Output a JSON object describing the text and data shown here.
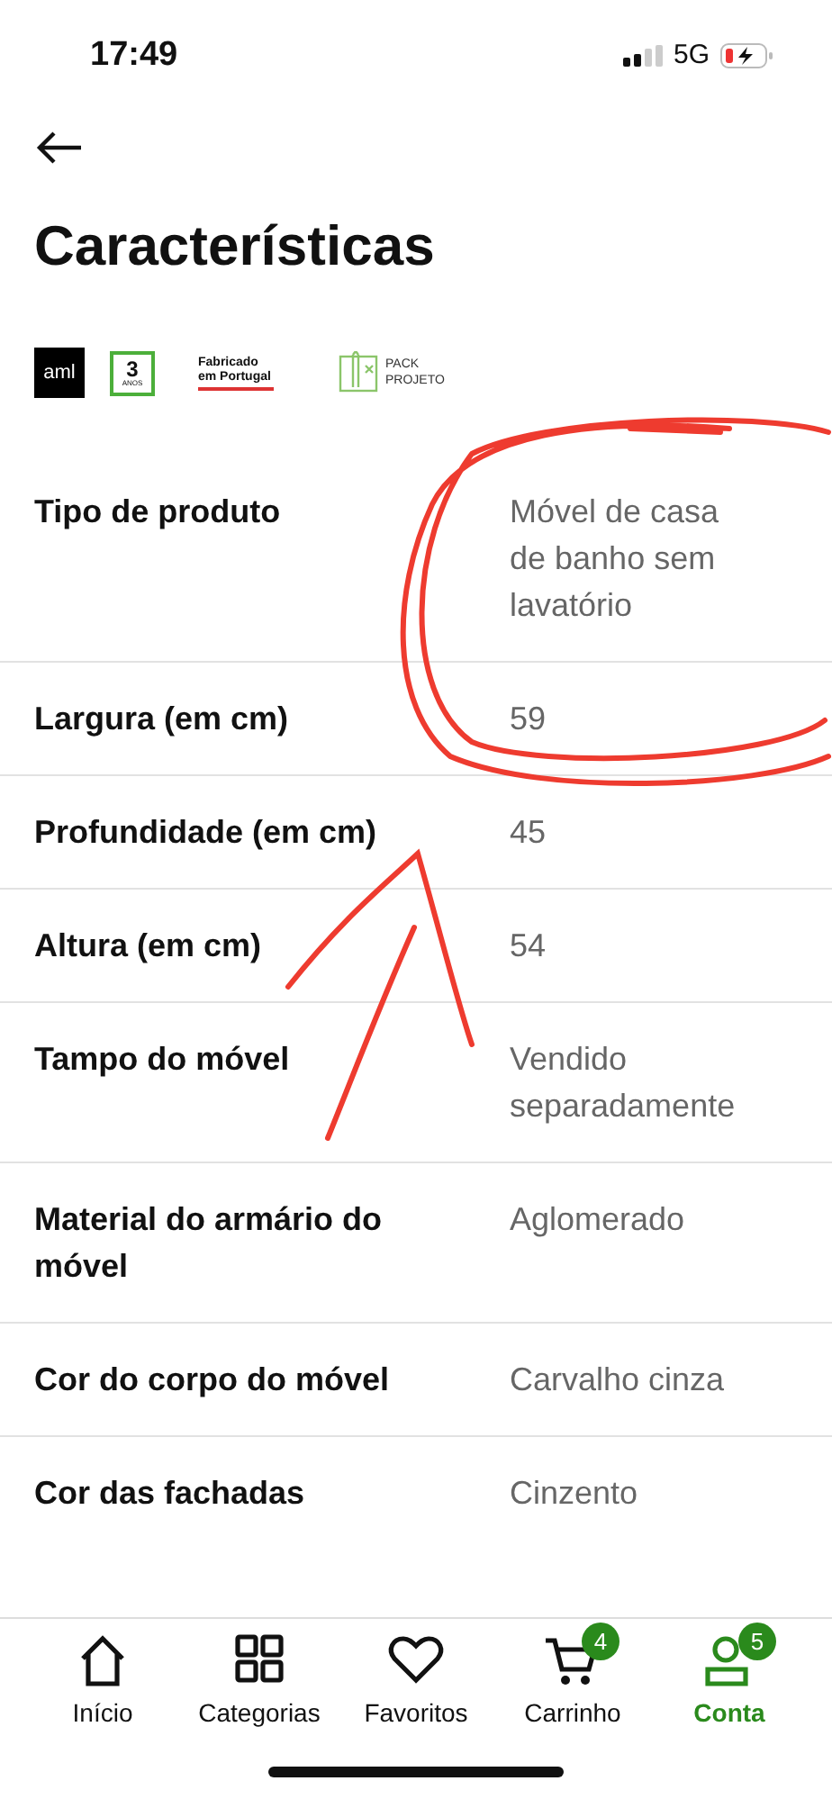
{
  "status_bar": {
    "time": "17:49",
    "network": "5G"
  },
  "header": {
    "title": "Características"
  },
  "badges": [
    {
      "kind": "aml",
      "text": "aml"
    },
    {
      "kind": "warranty",
      "text": "3",
      "sub": "ANOS"
    },
    {
      "kind": "made_in",
      "text": "Fabricado em Portugal"
    },
    {
      "kind": "pack",
      "text": "PACK PROJETO"
    }
  ],
  "specs": [
    {
      "label": "Tipo de produto",
      "value": "Móvel de casa de banho sem lavatório"
    },
    {
      "label": "Largura (em cm)",
      "value": "59"
    },
    {
      "label": "Profundidade (em cm)",
      "value": "45"
    },
    {
      "label": "Altura (em cm)",
      "value": "54"
    },
    {
      "label": "Tampo do móvel",
      "value": "Vendido separadamente"
    },
    {
      "label": "Material do armário do móvel",
      "value": "Aglomerado"
    },
    {
      "label": "Cor do corpo do móvel",
      "value": "Carvalho cinza"
    },
    {
      "label": "Cor das fachadas",
      "value": "Cinzento"
    }
  ],
  "nav": [
    {
      "kind": "home",
      "label": "Início",
      "selected": false
    },
    {
      "kind": "categories",
      "label": "Categorias",
      "selected": false
    },
    {
      "kind": "favorites",
      "label": "Favoritos",
      "selected": false
    },
    {
      "kind": "cart",
      "label": "Carrinho",
      "selected": false,
      "badge": "4"
    },
    {
      "kind": "account",
      "label": "Conta",
      "selected": true,
      "badge": "5"
    }
  ]
}
